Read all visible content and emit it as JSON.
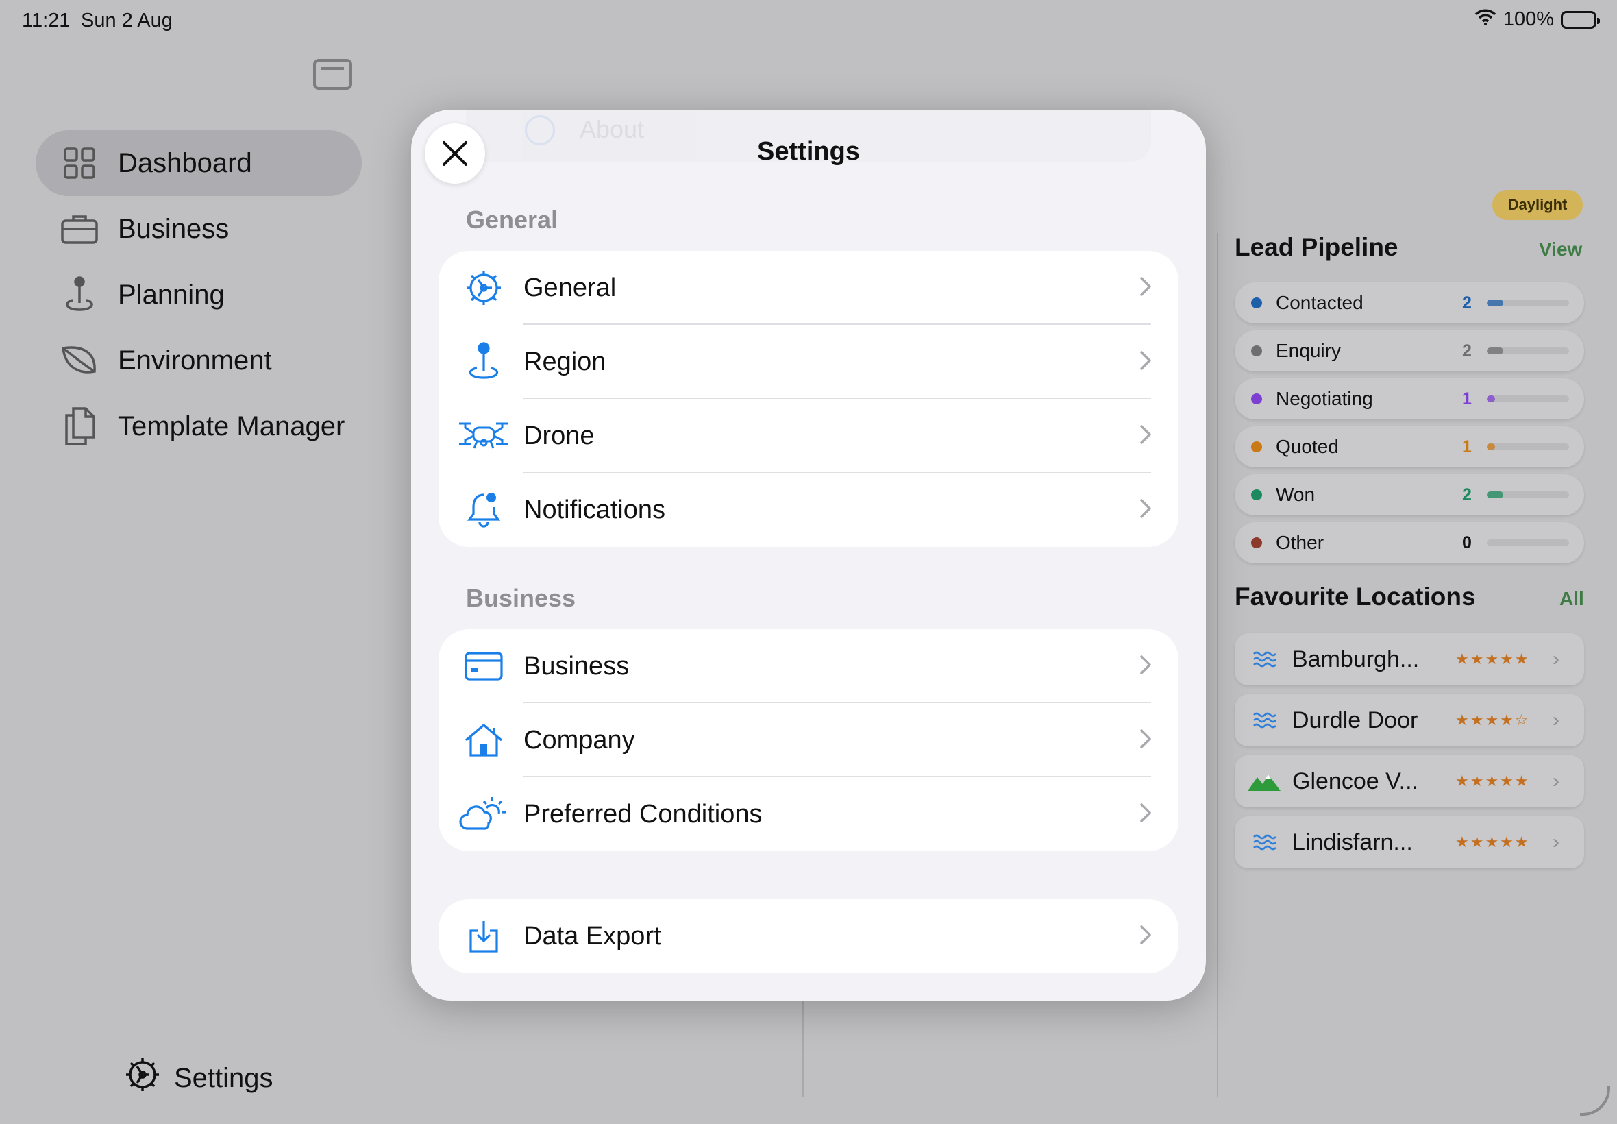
{
  "status_bar": {
    "time": "11:21",
    "date": "Sun 2 Aug",
    "battery": "100%"
  },
  "sidebar": {
    "items": [
      {
        "label": "Dashboard",
        "icon": "grid-icon",
        "active": true
      },
      {
        "label": "Business",
        "icon": "briefcase-icon"
      },
      {
        "label": "Planning",
        "icon": "map-pin-icon"
      },
      {
        "label": "Environment",
        "icon": "leaf-icon"
      },
      {
        "label": "Template Manager",
        "icon": "documents-icon"
      }
    ],
    "settings_label": "Settings"
  },
  "modal": {
    "title": "Settings",
    "ghost_label": "About",
    "sections": [
      {
        "header": "General",
        "rows": [
          {
            "label": "General",
            "icon": "gear-icon"
          },
          {
            "label": "Region",
            "icon": "map-pin-icon"
          },
          {
            "label": "Drone",
            "icon": "drone-icon"
          },
          {
            "label": "Notifications",
            "icon": "bell-badge-icon"
          }
        ]
      },
      {
        "header": "Business",
        "rows": [
          {
            "label": "Business",
            "icon": "credit-card-icon"
          },
          {
            "label": "Company",
            "icon": "house-icon"
          },
          {
            "label": "Preferred Conditions",
            "icon": "cloud-sun-icon"
          }
        ]
      },
      {
        "header": "",
        "rows": [
          {
            "label": "Data Export",
            "icon": "download-tray-icon"
          }
        ]
      }
    ]
  },
  "right_panel": {
    "badge": "Daylight",
    "lead_pipeline": {
      "title": "Lead Pipeline",
      "link": "View",
      "rows": [
        {
          "label": "Contacted",
          "count": "2",
          "color": "#1d5fa8",
          "fraction": 0.2
        },
        {
          "label": "Enquiry",
          "count": "2",
          "color": "#6e6e72",
          "fraction": 0.2
        },
        {
          "label": "Negotiating",
          "count": "1",
          "color": "#7d3fd1",
          "fraction": 0.1
        },
        {
          "label": "Quoted",
          "count": "1",
          "color": "#c97a17",
          "fraction": 0.1
        },
        {
          "label": "Won",
          "count": "2",
          "color": "#1c8a5e",
          "fraction": 0.2
        },
        {
          "label": "Other",
          "count": "0",
          "color": "#8c3a2c",
          "fraction": 0
        }
      ]
    },
    "favourite_locations": {
      "title": "Favourite Locations",
      "link": "All",
      "rows": [
        {
          "name": "Bamburgh...",
          "icon": "waves-icon",
          "stars": "★★★★★"
        },
        {
          "name": "Durdle Door",
          "icon": "waves-icon",
          "stars": "★★★★☆"
        },
        {
          "name": "Glencoe V...",
          "icon": "mountains-icon",
          "stars": "★★★★★"
        },
        {
          "name": "Lindisfarn...",
          "icon": "waves-icon",
          "stars": "★★★★★"
        }
      ]
    }
  },
  "colors": {
    "accent": "#1a7fe8",
    "link_green": "#3f7c45",
    "star_orange": "#c46f1f"
  }
}
